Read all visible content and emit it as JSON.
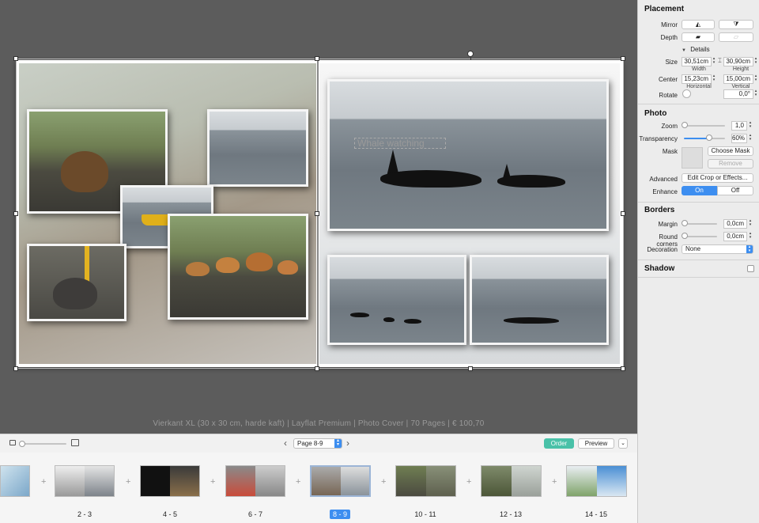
{
  "spread": {
    "title_text": "Whale watching"
  },
  "canvas": {
    "info": "Vierkant XL (30 x 30 cm, harde kaft)  |  Layflat Premium  |  Photo Cover  |  70 Pages  |  € 100,70"
  },
  "toolbar": {
    "page_selector": "Page 8-9",
    "order_label": "Order",
    "preview_label": "Preview",
    "accent": "#49c1a8"
  },
  "thumbnails": [
    {
      "label": "",
      "selected": false
    },
    {
      "label": "2 - 3",
      "selected": false
    },
    {
      "label": "4 - 5",
      "selected": false
    },
    {
      "label": "6 - 7",
      "selected": false
    },
    {
      "label": "8 - 9",
      "selected": true
    },
    {
      "label": "10 - 11",
      "selected": false
    },
    {
      "label": "12 - 13",
      "selected": false
    },
    {
      "label": "14 - 15",
      "selected": false
    }
  ],
  "panel": {
    "placement": {
      "title": "Placement",
      "mirror_label": "Mirror",
      "depth_label": "Depth",
      "details_label": "Details",
      "size_label": "Size",
      "width_value": "30,51cm",
      "height_value": "30,90cm",
      "width_caption": "Width",
      "height_caption": "Height",
      "center_label": "Center",
      "horizontal_value": "15,23cm",
      "vertical_value": "15,00cm",
      "horizontal_caption": "Horizontal",
      "vertical_caption": "Vertical",
      "rotate_label": "Rotate",
      "rotate_value": "0,0°"
    },
    "photo": {
      "title": "Photo",
      "zoom_label": "Zoom",
      "zoom_value": "1,0",
      "zoom_level": 0.0,
      "transparency_label": "Transparency",
      "transparency_value": "60%",
      "transparency_level": 0.6,
      "mask_label": "Mask",
      "choose_mask": "Choose Mask",
      "remove": "Remove",
      "advanced_label": "Advanced",
      "edit_crop": "Edit Crop or Effects...",
      "enhance_label": "Enhance",
      "enhance_on": "On",
      "enhance_off": "Off"
    },
    "borders": {
      "title": "Borders",
      "margin_label": "Margin",
      "margin_value": "0,0cm",
      "round_label": "Round corners",
      "round_value": "0,0cm",
      "decoration_label": "Decoration",
      "decoration_value": "None"
    },
    "shadow": {
      "title": "Shadow"
    }
  }
}
